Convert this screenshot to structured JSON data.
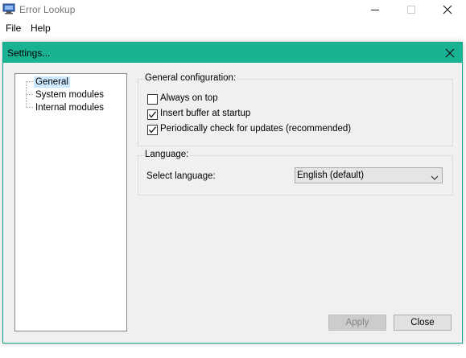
{
  "app": {
    "title": "Error Lookup",
    "icon": "monitor-icon"
  },
  "menu": {
    "items": [
      {
        "label": "File"
      },
      {
        "label": "Help"
      }
    ]
  },
  "dialog": {
    "title": "Settings...",
    "tree": {
      "items": [
        {
          "label": "General",
          "selected": true
        },
        {
          "label": "System modules",
          "selected": false
        },
        {
          "label": "Internal modules",
          "selected": false
        }
      ]
    },
    "general_group": {
      "label": "General configuration:",
      "options": [
        {
          "label": "Always on top",
          "checked": false
        },
        {
          "label": "Insert buffer at startup",
          "checked": true
        },
        {
          "label": "Periodically check for updates (recommended)",
          "checked": true
        }
      ]
    },
    "language_group": {
      "label": "Language:",
      "select_label": "Select language:",
      "selected_value": "English (default)"
    },
    "buttons": {
      "apply_label": "Apply",
      "close_label": "Close",
      "apply_enabled": false
    },
    "colors": {
      "titlebar": "#19b394",
      "selection": "#cce8ff"
    }
  }
}
